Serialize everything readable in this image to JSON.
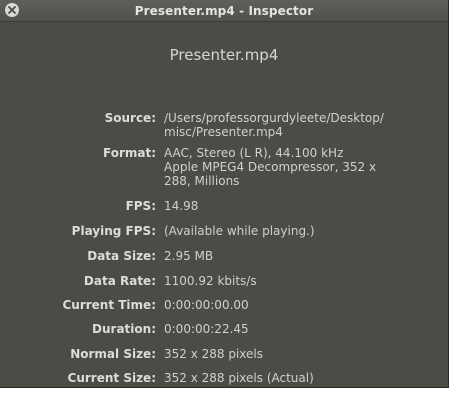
{
  "window": {
    "title": "Presenter.mp4 - Inspector"
  },
  "file_name": "Presenter.mp4",
  "fields": {
    "source": {
      "label": "Source:",
      "lines": [
        "/Users/professorgurdyleete/Desktop/",
        "misc/Presenter.mp4"
      ]
    },
    "format": {
      "label": "Format:",
      "lines": [
        "AAC, Stereo (L R), 44.100 kHz",
        "Apple MPEG4 Decompressor, 352 x",
        "288, Millions"
      ]
    },
    "fps": {
      "label": "FPS:",
      "value": "14.98"
    },
    "playing_fps": {
      "label": "Playing FPS:",
      "value": "(Available while playing.)"
    },
    "data_size": {
      "label": "Data Size:",
      "value": "2.95 MB"
    },
    "data_rate": {
      "label": "Data Rate:",
      "value": "1100.92 kbits/s"
    },
    "current_time": {
      "label": "Current Time:",
      "value": "0:00:00:00.00"
    },
    "duration": {
      "label": "Duration:",
      "value": "0:00:00:22.45"
    },
    "normal_size": {
      "label": "Normal Size:",
      "value": "352 x 288 pixels"
    },
    "current_size": {
      "label": "Current Size:",
      "value": "352 x 288 pixels (Actual)"
    }
  },
  "icons": {
    "close": "close-icon"
  }
}
